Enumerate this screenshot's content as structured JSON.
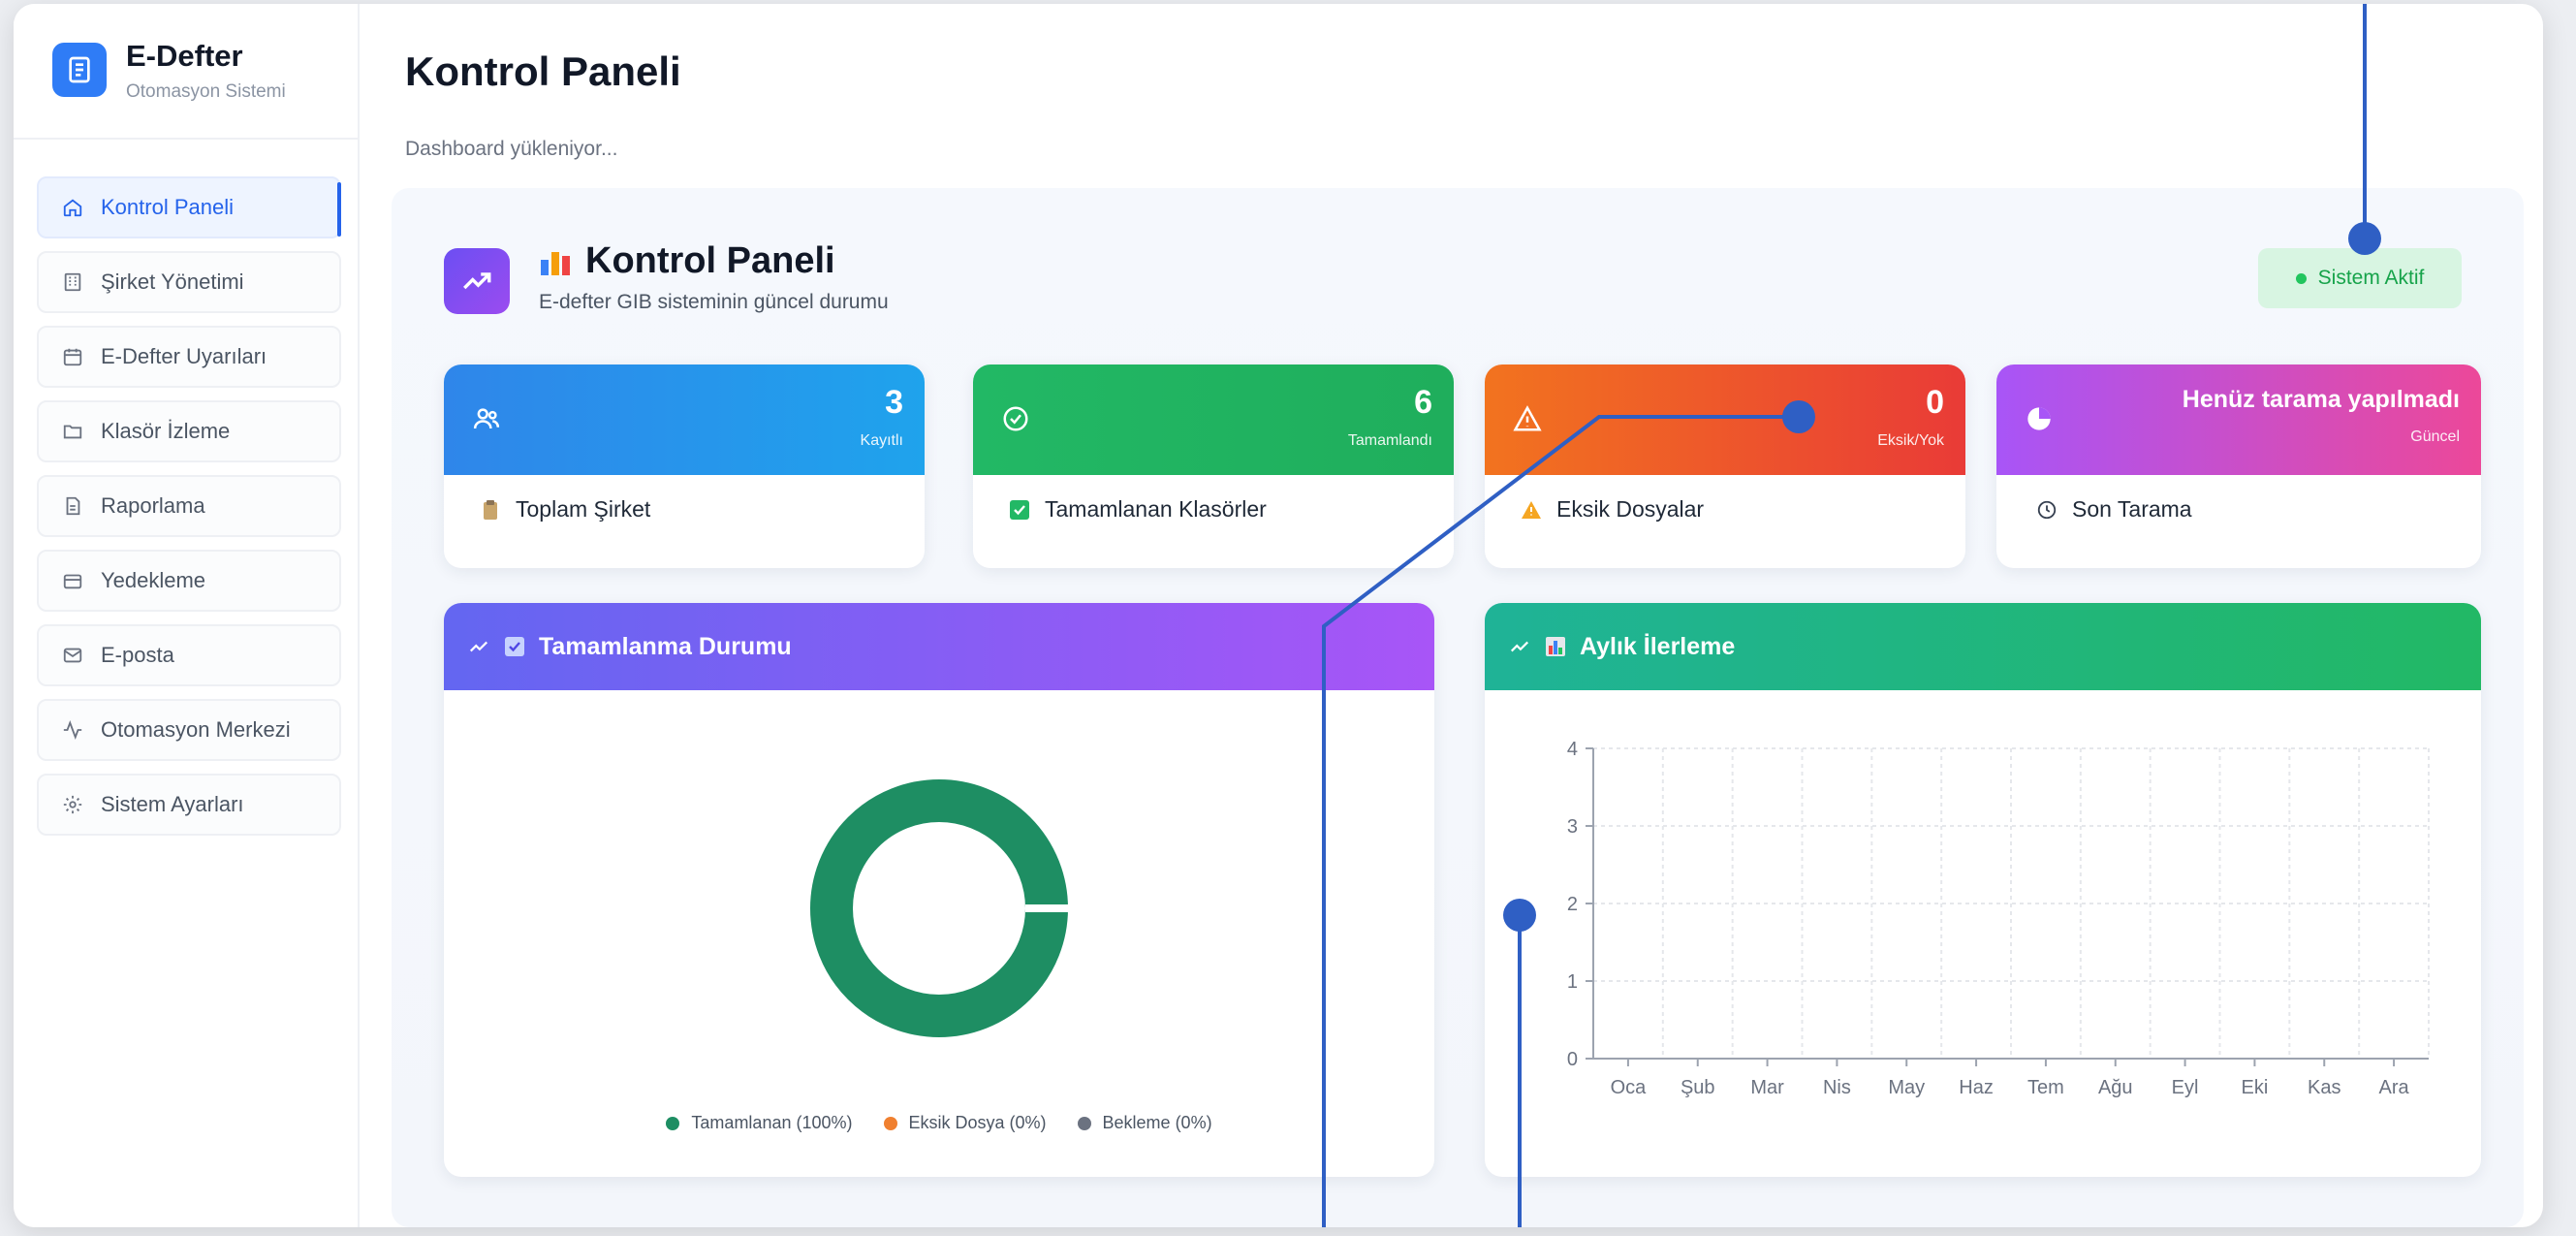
{
  "brand": {
    "title": "E-Defter",
    "subtitle": "Otomasyon Sistemi"
  },
  "sidebar": {
    "items": [
      {
        "label": "Kontrol Paneli",
        "icon": "home-icon",
        "active": true
      },
      {
        "label": "Şirket Yönetimi",
        "icon": "building-icon"
      },
      {
        "label": "E-Defter Uyarıları",
        "icon": "calendar-icon"
      },
      {
        "label": "Klasör İzleme",
        "icon": "folder-icon"
      },
      {
        "label": "Raporlama",
        "icon": "report-icon"
      },
      {
        "label": "Yedekleme",
        "icon": "archive-icon"
      },
      {
        "label": "E-posta",
        "icon": "mail-icon"
      },
      {
        "label": "Otomasyon Merkezi",
        "icon": "activity-icon"
      },
      {
        "label": "Sistem Ayarları",
        "icon": "gear-icon"
      }
    ]
  },
  "header": {
    "title": "Kontrol Paneli",
    "loading": "Dashboard yükleniyor..."
  },
  "panel": {
    "title": "Kontrol Paneli",
    "subtitle": "E-defter GIB sisteminin güncel durumu",
    "badge": "Sistem Aktif"
  },
  "stats": [
    {
      "value": "3",
      "caption": "Kayıtlı",
      "label": "Toplam Şirket"
    },
    {
      "value": "6",
      "caption": "Tamamlandı",
      "label": "Tamamlanan Klasörler"
    },
    {
      "value": "0",
      "caption": "Eksik/Yok",
      "label": "Eksik Dosyalar"
    },
    {
      "value": "Henüz tarama yapılmadı",
      "caption": "Güncel",
      "label": "Son Tarama"
    }
  ],
  "donut": {
    "title": "Tamamlanma Durumu",
    "legend": [
      "Tamamlanan (100%)",
      "Eksik Dosya (0%)",
      "Bekleme (0%)"
    ]
  },
  "colors": {
    "blue_card": "#2f86ea",
    "green_card": "#22b865",
    "red_card": "#ee4e2b",
    "purple_card": "#b24fe6",
    "donut_green": "#1e8e63",
    "orange": "#f08030",
    "gray": "#6b7280",
    "accent": "#2563eb",
    "annotation": "#2f5fc4"
  },
  "chart_data": {
    "type": "line",
    "title": "Aylık İlerleme",
    "categories": [
      "Oca",
      "Şub",
      "Mar",
      "Nis",
      "May",
      "Haz",
      "Tem",
      "Ağu",
      "Eyl",
      "Eki",
      "Kas",
      "Ara"
    ],
    "series": [],
    "ylim": [
      0,
      4
    ],
    "yticks": [
      "0",
      "1",
      "2",
      "3",
      "4"
    ],
    "grid": true
  }
}
